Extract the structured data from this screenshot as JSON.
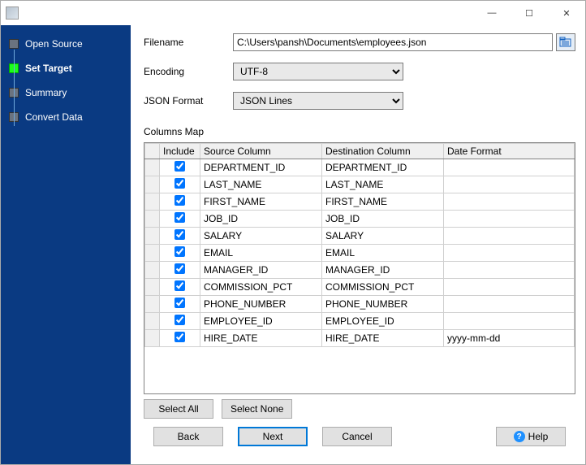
{
  "titlebar": {
    "min": "—",
    "max": "☐",
    "close": "✕"
  },
  "sidebar": {
    "steps": [
      {
        "label": "Open Source",
        "active": false
      },
      {
        "label": "Set Target",
        "active": true
      },
      {
        "label": "Summary",
        "active": false
      },
      {
        "label": "Convert Data",
        "active": false
      }
    ]
  },
  "form": {
    "filename_label": "Filename",
    "filename_value": "C:\\Users\\pansh\\Documents\\employees.json",
    "encoding_label": "Encoding",
    "encoding_value": "UTF-8",
    "json_format_label": "JSON Format",
    "json_format_value": "JSON Lines"
  },
  "columns_map": {
    "title": "Columns Map",
    "headers": {
      "include": "Include",
      "source": "Source Column",
      "destination": "Destination Column",
      "date_format": "Date Format"
    },
    "rows": [
      {
        "include": true,
        "source": "DEPARTMENT_ID",
        "destination": "DEPARTMENT_ID",
        "date_format": ""
      },
      {
        "include": true,
        "source": "LAST_NAME",
        "destination": "LAST_NAME",
        "date_format": ""
      },
      {
        "include": true,
        "source": "FIRST_NAME",
        "destination": "FIRST_NAME",
        "date_format": ""
      },
      {
        "include": true,
        "source": "JOB_ID",
        "destination": "JOB_ID",
        "date_format": ""
      },
      {
        "include": true,
        "source": "SALARY",
        "destination": "SALARY",
        "date_format": ""
      },
      {
        "include": true,
        "source": "EMAIL",
        "destination": "EMAIL",
        "date_format": ""
      },
      {
        "include": true,
        "source": "MANAGER_ID",
        "destination": "MANAGER_ID",
        "date_format": ""
      },
      {
        "include": true,
        "source": "COMMISSION_PCT",
        "destination": "COMMISSION_PCT",
        "date_format": ""
      },
      {
        "include": true,
        "source": "PHONE_NUMBER",
        "destination": "PHONE_NUMBER",
        "date_format": ""
      },
      {
        "include": true,
        "source": "EMPLOYEE_ID",
        "destination": "EMPLOYEE_ID",
        "date_format": ""
      },
      {
        "include": true,
        "source": "HIRE_DATE",
        "destination": "HIRE_DATE",
        "date_format": "yyyy-mm-dd"
      }
    ]
  },
  "buttons": {
    "select_all": "Select All",
    "select_none": "Select None",
    "back": "Back",
    "next": "Next",
    "cancel": "Cancel",
    "help": "Help"
  }
}
